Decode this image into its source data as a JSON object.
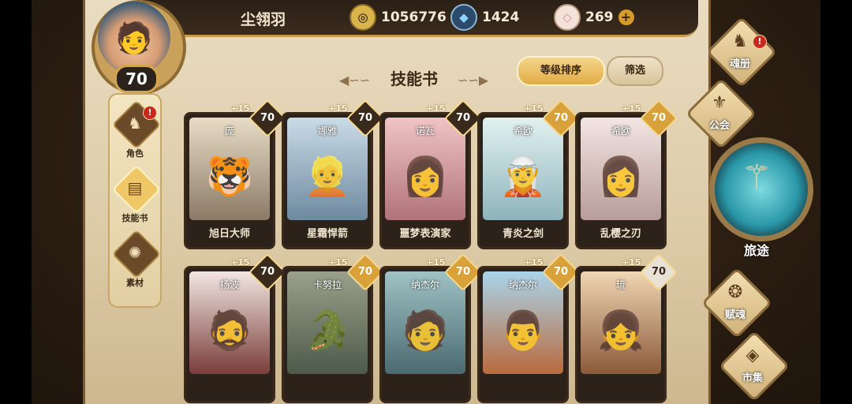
{
  "player": {
    "name": "尘翎羽",
    "level": "70"
  },
  "resources": [
    {
      "icon": "gold-coin-icon",
      "value": "1056776",
      "color": "#d9b34b"
    },
    {
      "icon": "blue-crystal-icon",
      "value": "1424",
      "color": "#5fb6e8"
    },
    {
      "icon": "pink-gem-icon",
      "value": "269",
      "color": "#e6b9a6"
    }
  ],
  "add_label": "+",
  "nav": [
    {
      "label": "角色",
      "badge": "!"
    },
    {
      "label": "技能书"
    },
    {
      "label": "素材"
    }
  ],
  "page": {
    "title": "技能书",
    "sort_label": "等级排序",
    "filter_label": "筛选"
  },
  "cards": [
    {
      "hero": "庞",
      "skill": "旭日大师",
      "plus": "+15",
      "level": "70",
      "art_color": "#8a7a66"
    },
    {
      "hero": "娜雅",
      "skill": "星霜悍箭",
      "plus": "+15",
      "level": "70",
      "art_color": "#6e8aa0"
    },
    {
      "hero": "诺瓦",
      "skill": "噩梦表演家",
      "plus": "+15",
      "level": "70",
      "art_color": "#b0737a"
    },
    {
      "hero": "希欧",
      "skill": "青炎之剑",
      "plus": "+15",
      "level": "70",
      "art_color": "#8db4bb"
    },
    {
      "hero": "希欧",
      "skill": "乱樱之刃",
      "plus": "+15",
      "level": "70",
      "art_color": "#b79c9a"
    },
    {
      "hero": "扬波",
      "skill": "",
      "plus": "+15",
      "level": "70",
      "art_color": "#7a3d3a"
    },
    {
      "hero": "卡努拉",
      "skill": "",
      "plus": "+15",
      "level": "70",
      "art_color": "#4d5a4a"
    },
    {
      "hero": "纳杰尔",
      "skill": "",
      "plus": "+15",
      "level": "70",
      "art_color": "#4a6a70"
    },
    {
      "hero": "纳杰尔",
      "skill": "",
      "plus": "+15",
      "level": "70",
      "art_color": "#b96a3e"
    },
    {
      "hero": "琉",
      "skill": "",
      "plus": "+15",
      "level": "70",
      "art_color": "#8a5a3a"
    }
  ],
  "right_menu": {
    "soul_book": {
      "label": "魂册",
      "badge": "!"
    },
    "guild": {
      "label": "公会"
    },
    "journey": {
      "label": "旅途"
    },
    "fusion": {
      "label": "赋魂"
    },
    "market": {
      "label": "市集"
    }
  }
}
